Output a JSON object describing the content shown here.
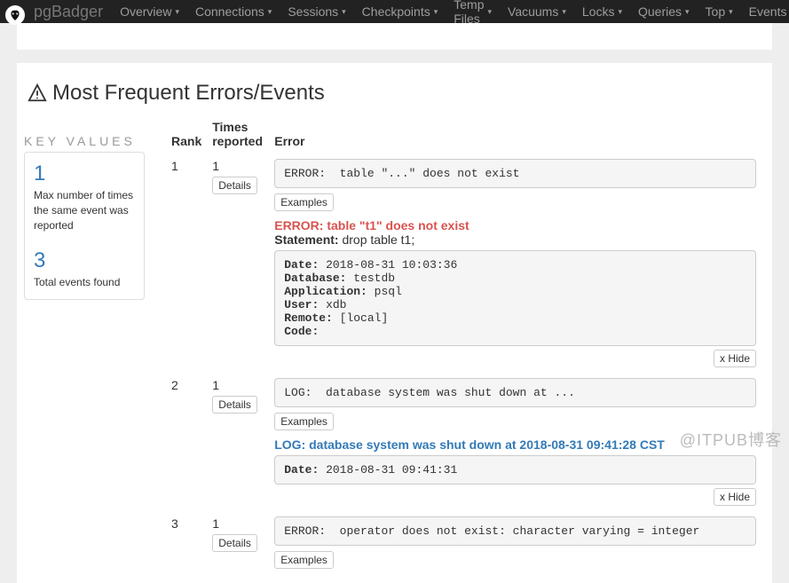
{
  "nav": {
    "brand": "pgBadger",
    "items": [
      "Overview",
      "Connections",
      "Sessions",
      "Checkpoints",
      "Temp Files",
      "Vacuums",
      "Locks",
      "Queries",
      "Top",
      "Events"
    ]
  },
  "panel": {
    "title": "Most Frequent Errors/Events"
  },
  "keyvalues": {
    "heading": "Key values",
    "rows": [
      {
        "big": "1",
        "desc": "Max number of times the same event was reported"
      },
      {
        "big": "3",
        "desc": "Total events found"
      }
    ]
  },
  "table": {
    "headers": {
      "rank": "Rank",
      "times": "Times reported",
      "error": "Error"
    },
    "detailsBtn": "Details",
    "examplesBtn": "Examples",
    "hideBtn": "x Hide",
    "rows": [
      {
        "rank": "1",
        "times": "1",
        "errorMono": "ERROR:  table \"...\" does not exist",
        "kind": "error",
        "errLabel": "ERROR:",
        "errText": "table \"t1\" does not exist",
        "stmtLabel": "Statement:",
        "stmtText": " drop table t1;",
        "detail": {
          "Date": "2018-08-31 10:03:36",
          "Database": "testdb",
          "Application": "psql",
          "User": "xdb",
          "Remote": "[local]",
          "Code": ""
        }
      },
      {
        "rank": "2",
        "times": "1",
        "errorMono": "LOG:  database system was shut down at ...",
        "kind": "log",
        "errLabel": "LOG:",
        "errText": "database system was shut down at 2018-08-31 09:41:28 CST",
        "detail": {
          "Date": "2018-08-31 09:41:31"
        }
      },
      {
        "rank": "3",
        "times": "1",
        "errorMono": "ERROR:  operator does not exist: character varying = integer"
      }
    ]
  },
  "watermark": "@ITPUB博客"
}
